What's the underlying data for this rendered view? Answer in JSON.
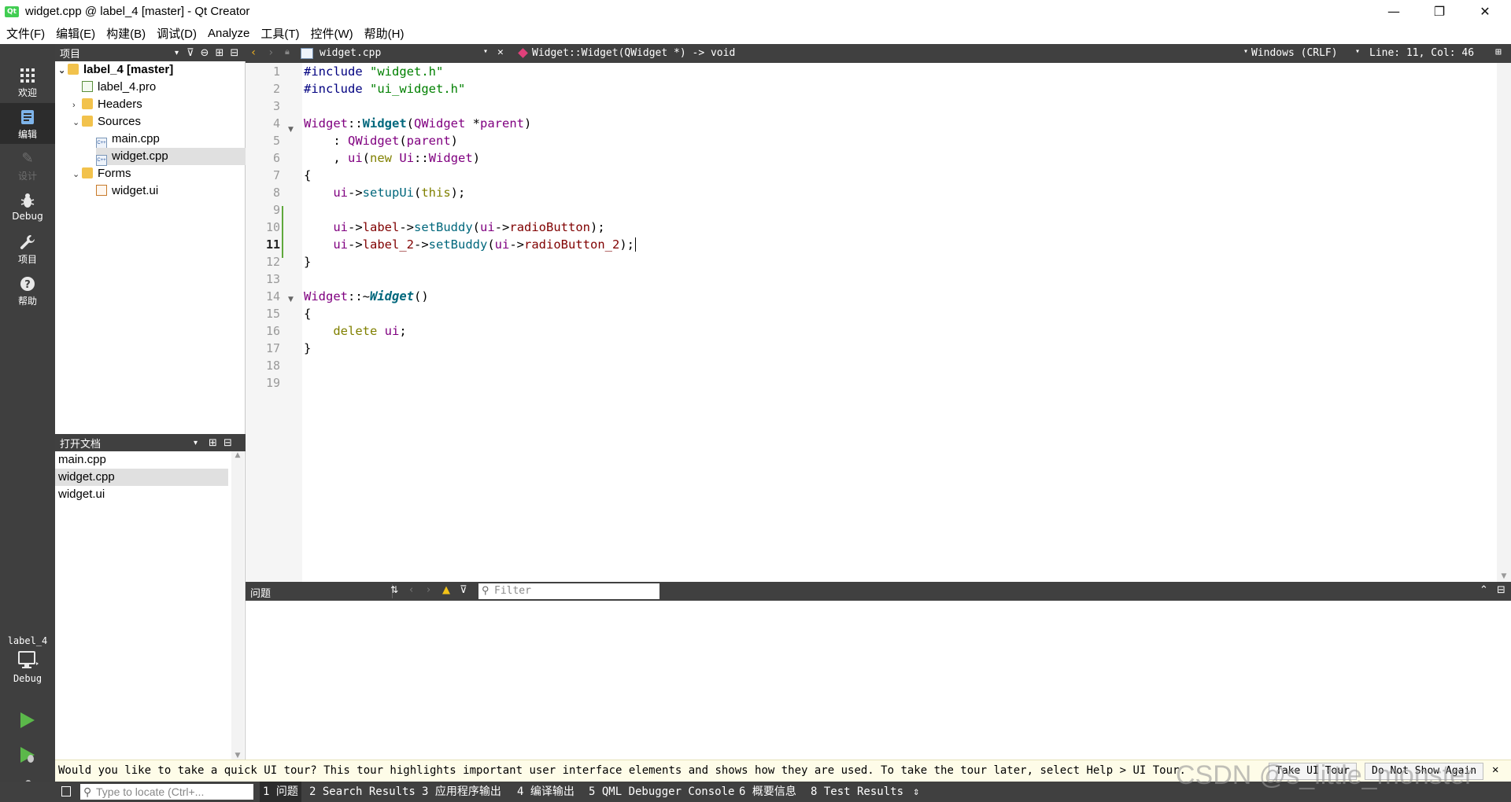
{
  "window": {
    "title": "widget.cpp @ label_4 [master] - Qt Creator",
    "logo": "Qt",
    "minimize": "—",
    "maximize": "❐",
    "close": "✕"
  },
  "menu": [
    "文件(F)",
    "编辑(E)",
    "构建(B)",
    "调试(D)",
    "Analyze",
    "工具(T)",
    "控件(W)",
    "帮助(H)"
  ],
  "modes": [
    {
      "label": "欢迎",
      "icon": "grid-icon"
    },
    {
      "label": "编辑",
      "icon": "edit-icon"
    },
    {
      "label": "设计",
      "icon": "pencil-icon"
    },
    {
      "label": "Debug",
      "icon": "bug-icon"
    },
    {
      "label": "项目",
      "icon": "wrench-icon"
    },
    {
      "label": "帮助",
      "icon": "help-icon"
    }
  ],
  "kit": {
    "project": "label_4",
    "config": "Debug"
  },
  "project_panel": {
    "title": "项目",
    "tree": [
      {
        "label": "label_4 [master]",
        "level": 0,
        "type": "project",
        "expanded": true
      },
      {
        "label": "label_4.pro",
        "level": 1,
        "type": "pro"
      },
      {
        "label": "Headers",
        "level": 1,
        "type": "folder",
        "expanded": false
      },
      {
        "label": "Sources",
        "level": 1,
        "type": "folder",
        "expanded": true
      },
      {
        "label": "main.cpp",
        "level": 2,
        "type": "cpp"
      },
      {
        "label": "widget.cpp",
        "level": 2,
        "type": "cpp",
        "selected": true
      },
      {
        "label": "Forms",
        "level": 1,
        "type": "folder",
        "expanded": true
      },
      {
        "label": "widget.ui",
        "level": 2,
        "type": "ui"
      }
    ]
  },
  "open_docs": {
    "title": "打开文档",
    "items": [
      "main.cpp",
      "widget.cpp",
      "widget.ui"
    ],
    "selected": "widget.cpp"
  },
  "editor_toolbar": {
    "file": "widget.cpp",
    "symbol": "Widget::Widget(QWidget *) -> void",
    "line_ending": "Windows (CRLF)",
    "position": "Line: 11, Col: 46"
  },
  "editor": {
    "current_line": 11,
    "lines": [
      "#include \"widget.h\"",
      "#include \"ui_widget.h\"",
      "",
      "Widget::Widget(QWidget *parent)",
      "    : QWidget(parent)",
      "    , ui(new Ui::Widget)",
      "{",
      "    ui->setupUi(this);",
      "",
      "    ui->label->setBuddy(ui->radioButton);",
      "    ui->label_2->setBuddy(ui->radioButton_2);",
      "",
      "",
      "Widget::~Widget()",
      "{",
      "    delete ui;",
      "}",
      "",
      ""
    ]
  },
  "issues": {
    "title": "问题",
    "filter_placeholder": "Filter"
  },
  "tour": {
    "message": "Would you like to take a quick UI tour? This tour highlights important user interface elements and shows how they are used. To take the tour later, select Help > UI Tour.",
    "take_label": "Take UI Tour",
    "dismiss_label": "Do Not Show Again"
  },
  "status": {
    "locator_placeholder": "Type to locate (Ctrl+...",
    "tabs": [
      "1 问题",
      "2 Search Results",
      "3 应用程序输出",
      "4 编译输出",
      "5 QML Debugger Console",
      "6 概要信息",
      "8 Test Results"
    ]
  },
  "watermark": "CSDN @s_little_monster",
  "colors": {
    "keyword": "#808000",
    "type": "#800080",
    "string": "#008000",
    "preprocessor": "#000080",
    "function": "#00677c",
    "member": "#800000"
  }
}
